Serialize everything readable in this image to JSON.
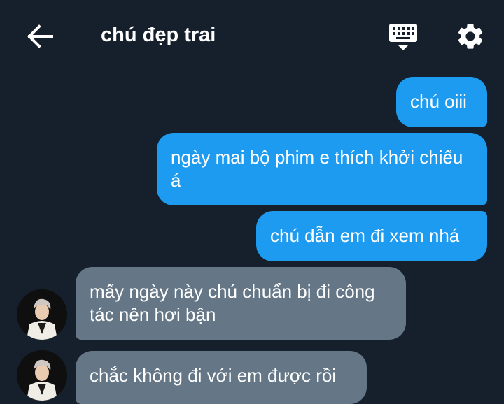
{
  "header": {
    "title": "chú đẹp trai"
  },
  "colors": {
    "background": "#16202c",
    "outgoing_bubble": "#1d9bf0",
    "incoming_bubble": "#657786",
    "text": "#ffffff"
  },
  "messages": [
    {
      "sender": "me",
      "text": "chú oiii"
    },
    {
      "sender": "me",
      "text": "ngày mai bộ phim e thích khởi chiếu á"
    },
    {
      "sender": "me",
      "text": "chú dẫn em đi xem nhá"
    },
    {
      "sender": "contact",
      "text": "mấy ngày này chú chuẩn bị đi công tác nên hơi bận"
    },
    {
      "sender": "contact",
      "text": "chắc không đi với em được rồi"
    }
  ],
  "icons": [
    "back-arrow-icon",
    "keyboard-icon",
    "gear-icon"
  ]
}
